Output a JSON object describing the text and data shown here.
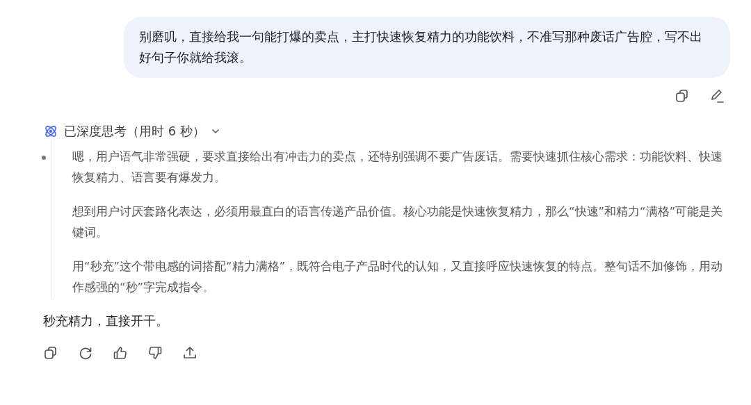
{
  "user_message": {
    "text": "别磨叽，直接给我一句能打爆的卖点，主打快速恢复精力的功能饮料，不准写那种废话广告腔，写不出好句子你就给我滚。"
  },
  "thinking": {
    "label": "已深度思考（用时 6 秒）",
    "expanded": true,
    "paragraphs": [
      "嗯，用户语气非常强硬，要求直接给出有冲击力的卖点，还特别强调不要广告废话。需要快速抓住核心需求：功能饮料、快速恢复精力、语言要有爆发力。",
      "想到用户讨厌套路化表达，必须用最直白的语言传递产品价值。核心功能是快速恢复精力，那么“快速”和精力“满格”可能是关键词。",
      "用“秒充”这个带电感的词搭配“精力满格”，既符合电子产品时代的认知，又直接呼应快速恢复的特点。整句话不加修饰，用动作感强的“秒”字完成指令。"
    ]
  },
  "answer": {
    "text": "秒充精力，直接开干。"
  }
}
